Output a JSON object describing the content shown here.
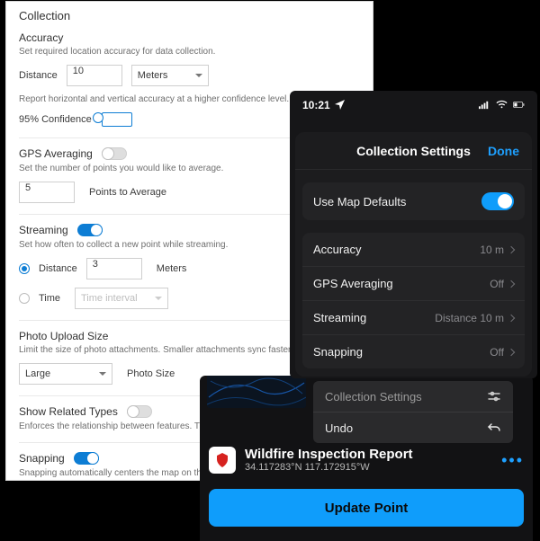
{
  "desktop": {
    "title": "Collection",
    "accuracy": {
      "heading": "Accuracy",
      "desc": "Set required location accuracy for data collection.",
      "distance_label": "Distance",
      "distance_value": "10",
      "unit_label": "Meters",
      "confidence_desc": "Report horizontal and vertical accuracy at a higher confidence level.",
      "confidence_label": "95% Confidence",
      "confidence_on": true
    },
    "gps": {
      "heading": "GPS Averaging",
      "on": false,
      "desc": "Set the number of points you would like to average.",
      "points_value": "5",
      "points_label": "Points to Average"
    },
    "streaming": {
      "heading": "Streaming",
      "on": true,
      "desc": "Set how often to collect a new point while streaming.",
      "mode_distance_label": "Distance",
      "mode_distance_selected": true,
      "distance_value": "3",
      "distance_unit": "Meters",
      "mode_time_label": "Time",
      "time_placeholder": "Time interval"
    },
    "photo": {
      "heading": "Photo Upload Size",
      "desc": "Limit the size of photo attachments. Smaller attachments sync faster.",
      "value": "Large",
      "suffix_label": "Photo Size"
    },
    "related": {
      "heading": "Show Related Types",
      "on": false,
      "desc": "Enforces the relationship between features. Turn on to show"
    },
    "snapping": {
      "heading": "Snapping",
      "on": true,
      "desc": "Snapping automatically centers the map on the location of"
    }
  },
  "phone_back": {
    "context_menu": {
      "header": "Collection Settings",
      "undo": "Undo"
    },
    "feature": {
      "title": "Wildfire Inspection Report",
      "subtitle": "34.117283°N  117.172915°W"
    },
    "primary_button": "Update Point"
  },
  "phone_front": {
    "status": {
      "time": "10:21"
    },
    "sheet": {
      "title": "Collection Settings",
      "done": "Done",
      "use_defaults_label": "Use Map Defaults",
      "use_defaults_on": true,
      "rows": {
        "accuracy": {
          "label": "Accuracy",
          "value": "10 m"
        },
        "gps": {
          "label": "GPS Averaging",
          "value": "Off"
        },
        "streaming": {
          "label": "Streaming",
          "value": "Distance 10 m"
        },
        "snapping": {
          "label": "Snapping",
          "value": "Off"
        }
      }
    }
  }
}
